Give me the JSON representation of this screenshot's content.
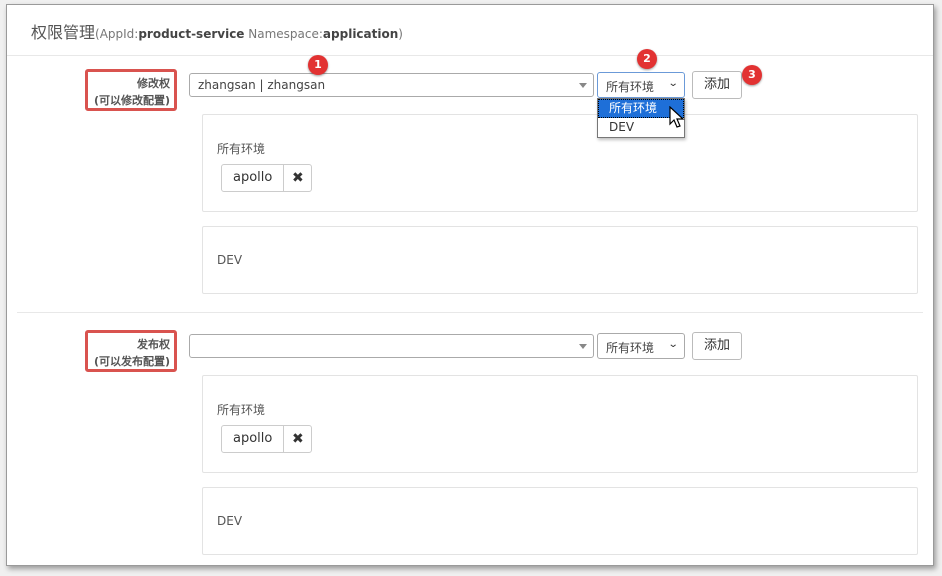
{
  "header": {
    "title": "权限管理",
    "appid_label": "(AppId:",
    "appid_value": "product-service",
    "namespace_label": " Namespace:",
    "namespace_value": "application",
    "close_paren": ")"
  },
  "sections": [
    {
      "label_line1": "修改权",
      "label_line2": "(可以修改配置)",
      "user_value": "zhangsan | zhangsan",
      "env_select": "所有环境",
      "add_label": "添加",
      "panels": [
        {
          "env": "所有环境",
          "tags": [
            "apollo"
          ]
        },
        {
          "env": "DEV",
          "tags": []
        }
      ]
    },
    {
      "label_line1": "发布权",
      "label_line2": "(可以发布配置)",
      "user_value": "",
      "env_select": "所有环境",
      "add_label": "添加",
      "panels": [
        {
          "env": "所有环境",
          "tags": [
            "apollo"
          ]
        },
        {
          "env": "DEV",
          "tags": []
        }
      ]
    }
  ],
  "dropdown": {
    "options": [
      "所有环境",
      "DEV"
    ],
    "highlighted_index": 0
  },
  "badges": [
    "1",
    "2",
    "3"
  ],
  "icons": {
    "remove": "close-icon",
    "dropdown": "chevron-down-icon",
    "cursor": "mouse-pointer-icon"
  },
  "colors": {
    "highlight": "#d9534f",
    "badge": "#e23232",
    "selected_option": "#1e6fd8"
  }
}
